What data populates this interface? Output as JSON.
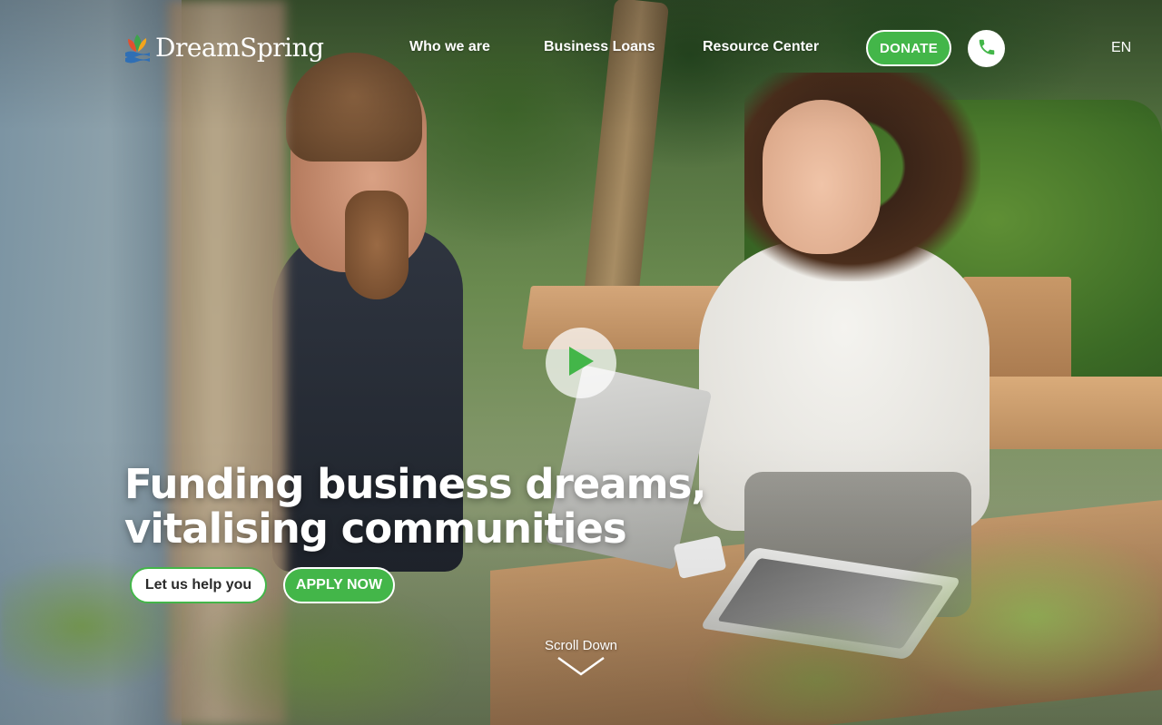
{
  "brand": {
    "name_part1": "Dream",
    "name_part2": "Spring",
    "logo_colors": [
      "#e2502f",
      "#3fa34d",
      "#f4a51c",
      "#2f6fb5"
    ]
  },
  "nav": {
    "items": [
      {
        "label": "Who we are"
      },
      {
        "label": "Business Loans"
      },
      {
        "label": "Resource Center"
      }
    ],
    "donate_label": "DONATE",
    "phone_icon": "phone-icon",
    "language": "EN"
  },
  "hero": {
    "headline_line1": "Funding business dreams,",
    "headline_line2": "vitalising communities",
    "help_button": "Let us help you",
    "apply_button": "APPLY NOW",
    "play_icon": "play-icon",
    "scroll_label": "Scroll Down",
    "scroll_icon": "chevron-down-icon"
  },
  "colors": {
    "accent_green": "#43b649",
    "text_white": "#ffffff"
  }
}
